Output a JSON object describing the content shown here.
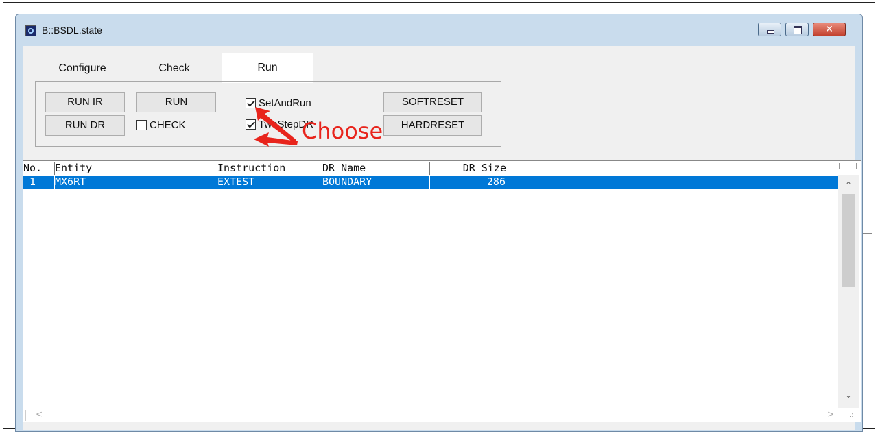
{
  "window": {
    "title": "B::BSDL.state",
    "icon": "app-icon",
    "controls": {
      "minimize": "minimize-icon",
      "maximize": "maximize-icon",
      "close": "✕"
    }
  },
  "tabs": [
    {
      "label": "Configure",
      "selected": false
    },
    {
      "label": "Check",
      "selected": false
    },
    {
      "label": "Run",
      "selected": true
    }
  ],
  "run_panel": {
    "buttons": {
      "run_ir": "RUN IR",
      "run_dr": "RUN DR",
      "run": "RUN",
      "softreset": "SOFTRESET",
      "hardreset": "HARDRESET"
    },
    "checkboxes": {
      "check": {
        "label": "CHECK",
        "checked": false
      },
      "set_and_run": {
        "label": "SetAndRun",
        "checked": true
      },
      "two_step_dr": {
        "label": "TwoStepDR",
        "checked": true
      }
    }
  },
  "annotation": {
    "text": "Choose",
    "color": "#e8241c"
  },
  "table": {
    "columns": [
      "No.",
      "Entity",
      "Instruction",
      "DR Name",
      "DR Size"
    ],
    "rows": [
      {
        "no": "1",
        "entity": "MX6RT",
        "instruction": "EXTEST",
        "dr_name": "BOUNDARY",
        "dr_size": "286",
        "selected": true
      }
    ]
  },
  "colors": {
    "selection": "#0078d7",
    "window_frame": "#c9dced",
    "client": "#f0f0f0"
  }
}
